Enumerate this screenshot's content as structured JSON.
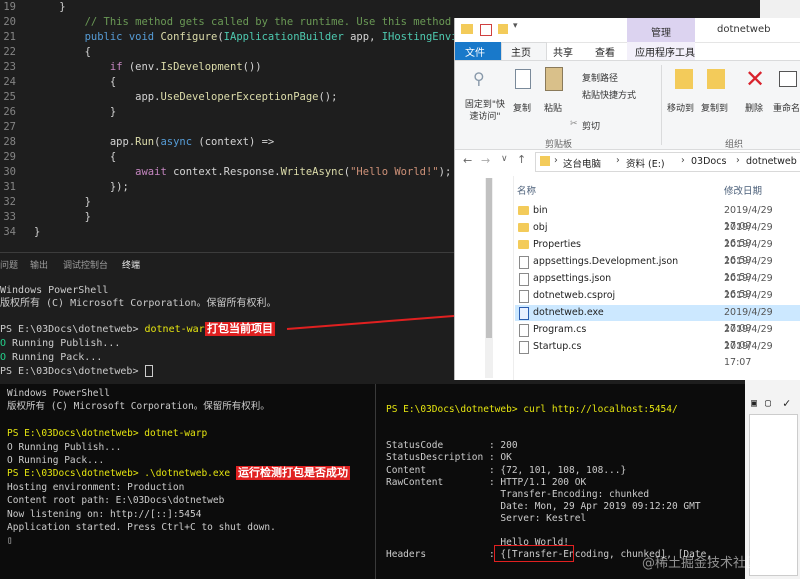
{
  "editor": {
    "lines": [
      {
        "no": "19",
        "seg": [
          [
            "    }",
            ""
          ]
        ]
      },
      {
        "no": "20",
        "seg": [
          [
            "",
            ""
          ],
          [
            "// This method gets called by the runtime. Use this method to",
            "cm"
          ]
        ]
      },
      {
        "no": "21",
        "seg": [
          [
            "public void ",
            "kw"
          ],
          [
            "Configure",
            "fn"
          ],
          [
            "(",
            ""
          ],
          [
            "IApplicationBuilder",
            "ty"
          ],
          [
            " app, ",
            ""
          ],
          [
            "IHostingEnvironment",
            "ty"
          ],
          [
            " env)",
            ""
          ]
        ]
      },
      {
        "no": "22",
        "seg": [
          [
            "{",
            ""
          ]
        ]
      },
      {
        "no": "23",
        "seg": [
          [
            "    ",
            ""
          ],
          [
            "if",
            "kc"
          ],
          [
            " (env.",
            ""
          ],
          [
            "IsDevelopment",
            "fn"
          ],
          [
            "())",
            ""
          ]
        ]
      },
      {
        "no": "24",
        "seg": [
          [
            "    {",
            ""
          ]
        ]
      },
      {
        "no": "25",
        "seg": [
          [
            "        app.",
            ""
          ],
          [
            "UseDeveloperExceptionPage",
            "fn"
          ],
          [
            "();",
            ""
          ]
        ]
      },
      {
        "no": "26",
        "seg": [
          [
            "    }",
            ""
          ]
        ]
      },
      {
        "no": "27",
        "seg": [
          [
            "",
            ""
          ]
        ]
      },
      {
        "no": "28",
        "seg": [
          [
            "    app.",
            ""
          ],
          [
            "Run",
            "fn"
          ],
          [
            "(",
            ""
          ],
          [
            "async",
            "kw"
          ],
          [
            " (context) =>",
            ""
          ]
        ]
      },
      {
        "no": "29",
        "seg": [
          [
            "    {",
            ""
          ]
        ]
      },
      {
        "no": "30",
        "seg": [
          [
            "        ",
            ""
          ],
          [
            "await",
            "kc"
          ],
          [
            " context.Response.",
            ""
          ],
          [
            "WriteAsync",
            "fn"
          ],
          [
            "(",
            ""
          ],
          [
            "\"Hello World!\"",
            "st"
          ],
          [
            ");",
            ""
          ]
        ]
      },
      {
        "no": "31",
        "seg": [
          [
            "    });",
            ""
          ]
        ]
      },
      {
        "no": "32",
        "seg": [
          [
            "}",
            ""
          ]
        ]
      },
      {
        "no": "33",
        "seg": [
          [
            "    }",
            ""
          ]
        ]
      },
      {
        "no": "34",
        "seg": [
          [
            "}",
            ""
          ]
        ]
      }
    ]
  },
  "panel": {
    "tabs": [
      "问题",
      "输出",
      "调试控制台",
      "终端"
    ]
  },
  "term1": {
    "l1": "Windows PowerShell",
    "l2": "版权所有 (C) Microsoft Corporation。保留所有权利。",
    "prompt": "PS E:\\03Docs\\dotnetweb> ",
    "cmd": "dotnet-warp",
    "annotation": "打包当前项目",
    "o1": "O",
    "o1t": " Running Publish...",
    "o2": "O",
    "o2t": " Running Pack...",
    "prompt2": "PS E:\\03Docs\\dotnetweb> "
  },
  "explorer": {
    "manage_tab": "管理",
    "title": "dotnetweb",
    "tabs": [
      "文件",
      "主页",
      "共享",
      "查看",
      "应用程序工具"
    ],
    "ribbon": {
      "pin": "固定到\"快速访问\"",
      "copy": "复制",
      "paste": "粘贴",
      "copy_path": "复制路径",
      "paste_shortcut": "粘贴快捷方式",
      "cut": "剪切",
      "group_clipboard": "剪贴板",
      "move_to": "移动到",
      "copy_to": "复制到",
      "delete": "删除",
      "rename": "重命名",
      "group_organize": "组织"
    },
    "breadcrumb": [
      "这台电脑",
      "资料 (E:)",
      "03Docs",
      "dotnetweb"
    ],
    "col_name": "名称",
    "col_date": "修改日期",
    "files": [
      {
        "name": "bin",
        "date": "2019/4/29 17:09",
        "type": "folder"
      },
      {
        "name": "obj",
        "date": "2019/4/29 16:59",
        "type": "folder"
      },
      {
        "name": "Properties",
        "date": "2019/4/29 16:59",
        "type": "folder"
      },
      {
        "name": "appsettings.Development.json",
        "date": "2019/4/29 16:59",
        "type": "file"
      },
      {
        "name": "appsettings.json",
        "date": "2019/4/29 16:59",
        "type": "file"
      },
      {
        "name": "dotnetweb.csproj",
        "date": "2019/4/29 17:07",
        "type": "file"
      },
      {
        "name": "dotnetweb.exe",
        "date": "2019/4/29 17:09",
        "type": "exe"
      },
      {
        "name": "Program.cs",
        "date": "2019/4/29 17:07",
        "type": "file"
      },
      {
        "name": "Startup.cs",
        "date": "2019/4/29 17:07",
        "type": "file"
      }
    ]
  },
  "term2": {
    "left": [
      "Windows PowerShell",
      "版权所有 (C) Microsoft Corporation。保留所有权利。",
      "",
      "PS E:\\03Docs\\dotnetweb> dotnet-warp",
      "O Running Publish...",
      "O Running Pack...",
      "PS E:\\03Docs\\dotnetweb> .\\dotnetweb.exe",
      "Hosting environment: Production",
      "Content root path: E:\\03Docs\\dotnetweb",
      "Now listening on: http://[::]:5454",
      "Application started. Press Ctrl+C to shut down.",
      "▯"
    ],
    "annotation": "运行检测打包是否成功",
    "right": [
      "PS E:\\03Docs\\dotnetweb> curl http://localhost:5454/",
      "",
      "",
      "StatusCode        : 200",
      "StatusDescription : OK",
      "Content           : {72, 101, 108, 108...}",
      "RawContent        : HTTP/1.1 200 OK",
      "                    Transfer-Encoding: chunked",
      "                    Date: Mon, 29 Apr 2019 09:12:20 GMT",
      "                    Server: Kestrel",
      "",
      "                    Hello World!",
      "Headers           : {[Transfer-Encoding, chunked], [Date,"
    ]
  },
  "watermark": "@稀土掘金技术社区",
  "colors": {
    "annotation": "#e02020",
    "editor_bg": "#1e1e1e",
    "terminal_bg": "#0c0c0c"
  }
}
